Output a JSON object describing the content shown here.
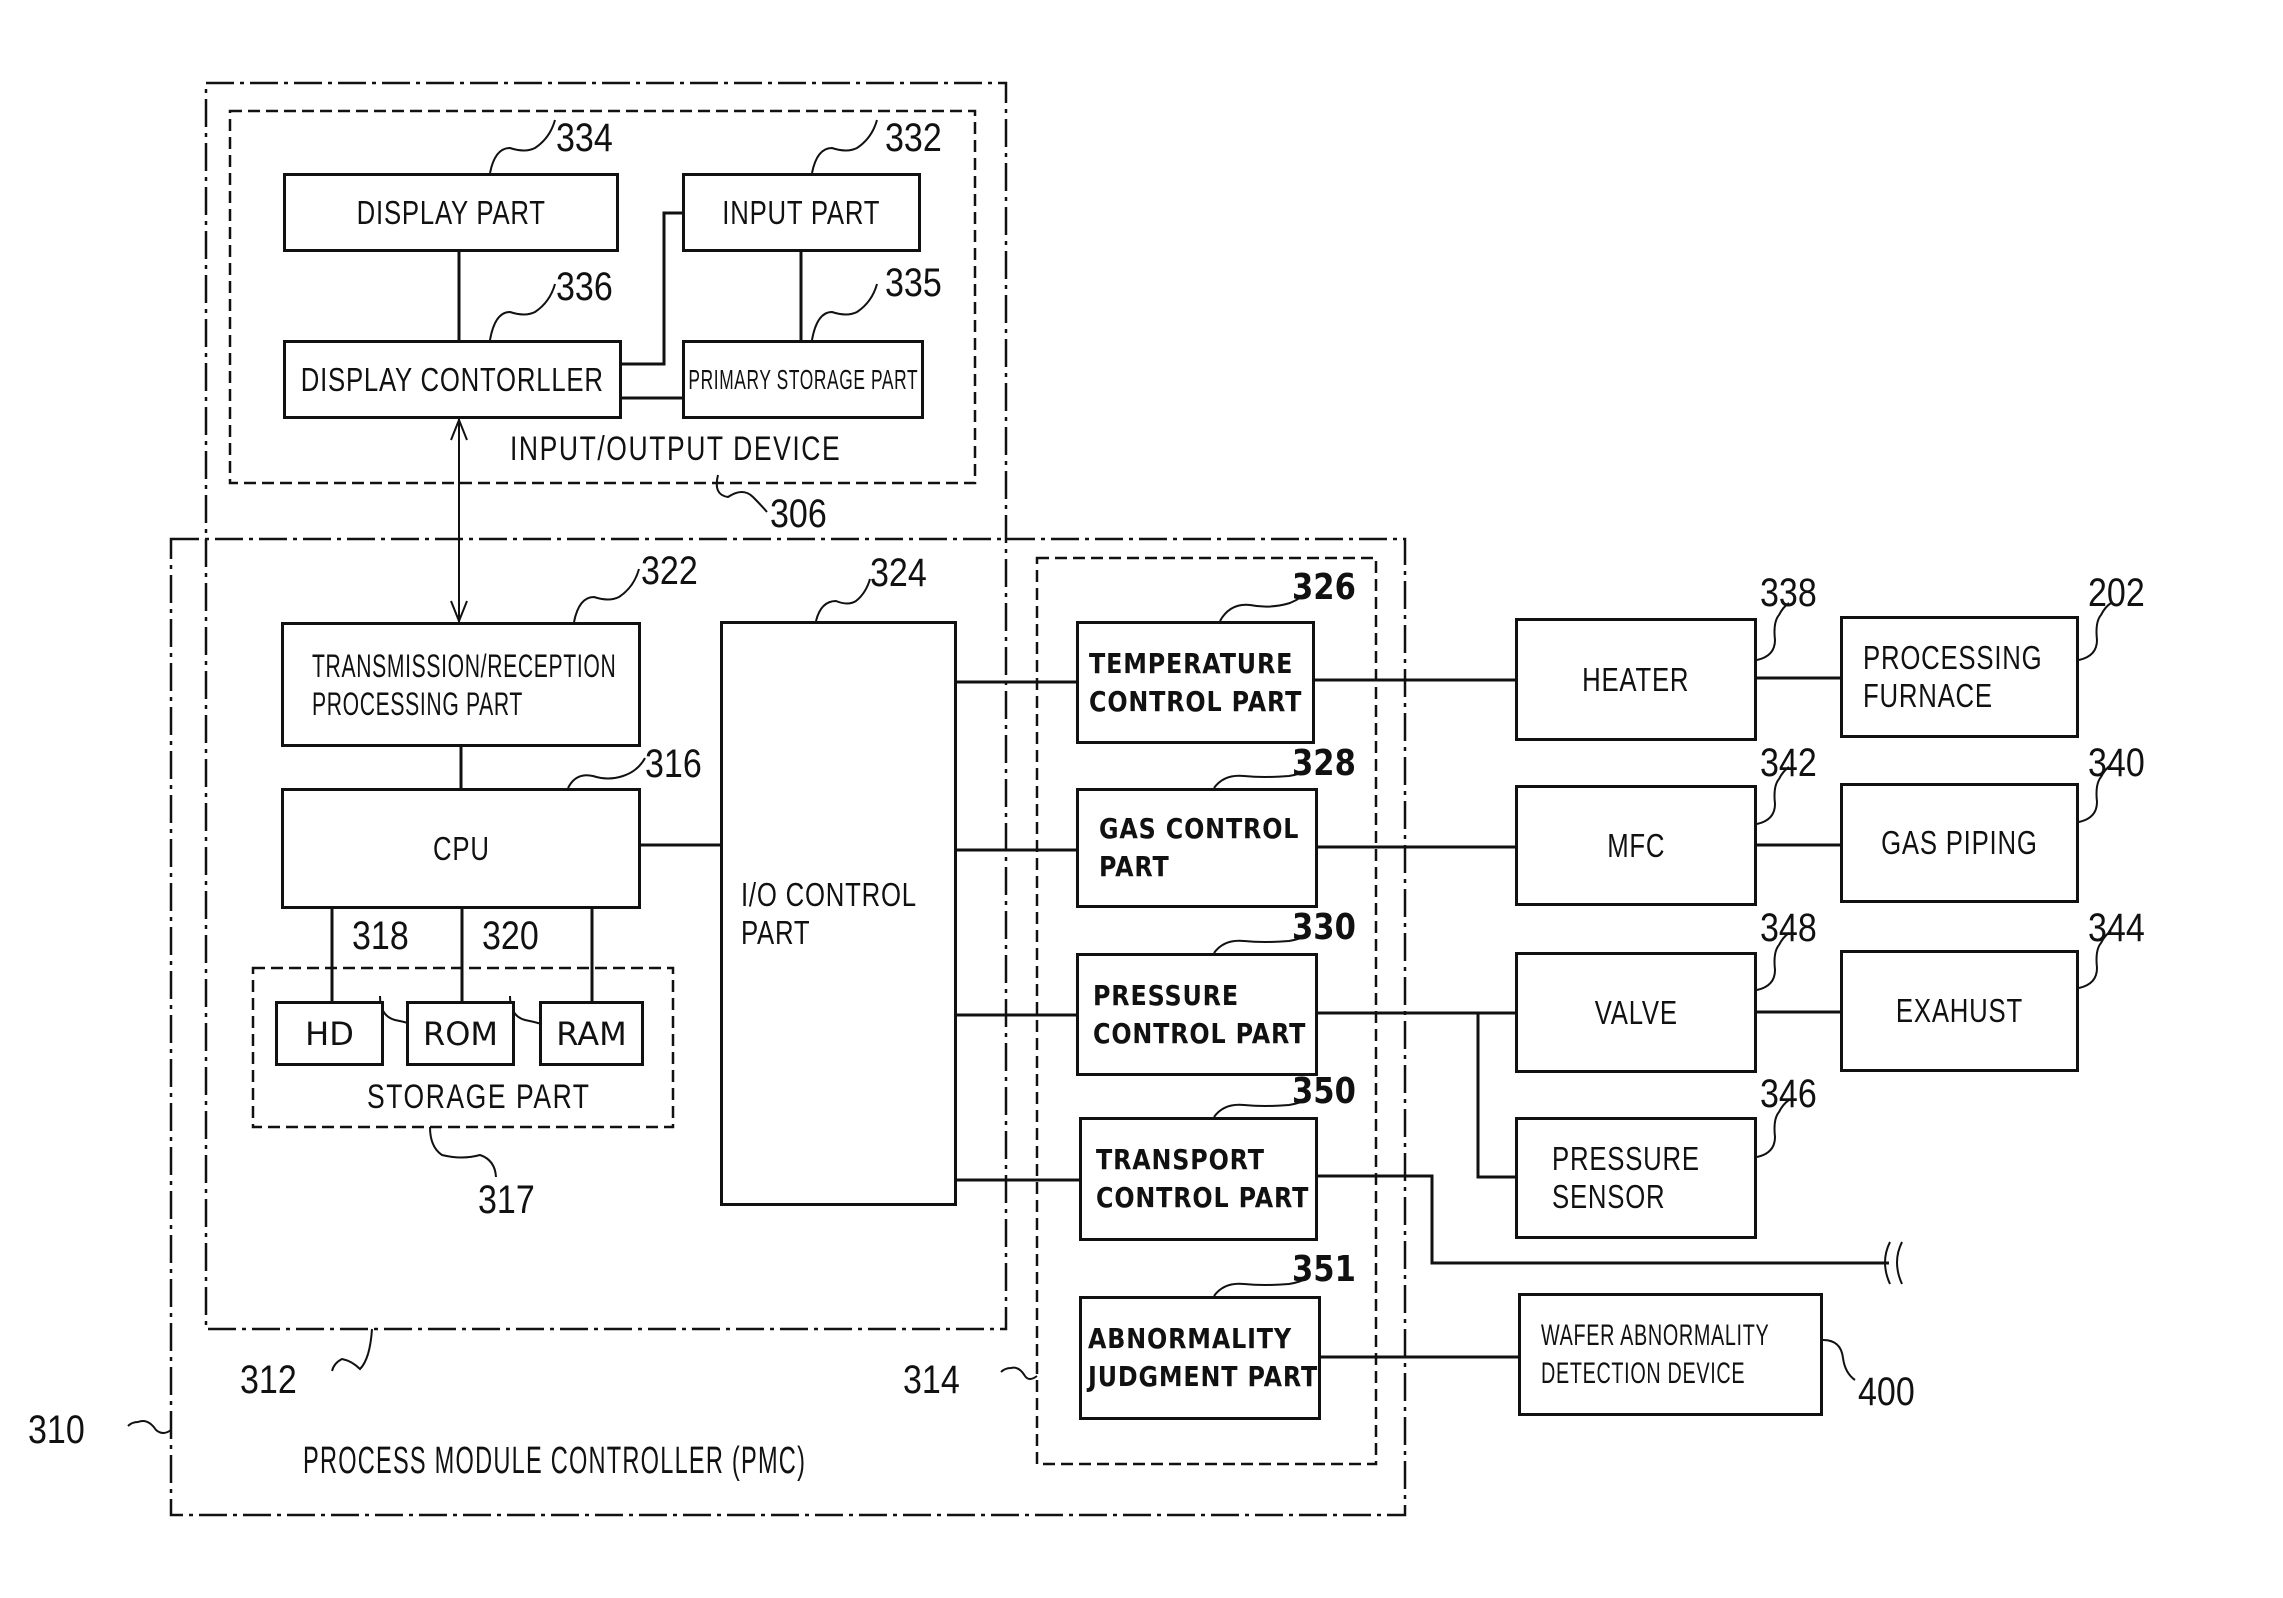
{
  "figure": {
    "groups": {
      "pmc": {
        "label": "PROCESS MODULE CONTROLLER (PMC)",
        "ref": "310"
      },
      "main_controller": {
        "ref": "312"
      },
      "io_device": {
        "label": "INPUT/OUTPUT DEVICE",
        "ref": "306"
      },
      "control_parts": {
        "ref": "314"
      },
      "storage": {
        "label": "STORAGE PART",
        "ref": "317"
      }
    },
    "blocks": {
      "display_part": {
        "label": "DISPLAY PART",
        "ref": "334"
      },
      "input_part": {
        "label": "INPUT PART",
        "ref": "332"
      },
      "display_controller": {
        "label": "DISPLAY CONTORLLER",
        "ref": "336"
      },
      "primary_storage": {
        "label": "PRIMARY STORAGE PART",
        "ref": "335"
      },
      "trans_recep": {
        "label": "TRANSMISSION/RECEPTION\nPROCESSING PART",
        "ref": "322"
      },
      "cpu": {
        "label": "CPU",
        "ref": "316"
      },
      "hd": {
        "label": "HD"
      },
      "rom": {
        "label": "ROM",
        "ref": "318"
      },
      "ram": {
        "label": "RAM",
        "ref": "320"
      },
      "io_control": {
        "label": "I/O CONTROL\nPART",
        "ref": "324"
      },
      "temp_control": {
        "label": "TEMPERATURE\nCONTROL PART",
        "ref": "326"
      },
      "gas_control": {
        "label": "GAS CONTROL\nPART",
        "ref": "328"
      },
      "pressure_control": {
        "label": "PRESSURE\nCONTROL PART",
        "ref": "330"
      },
      "transport_control": {
        "label": "TRANSPORT\nCONTROL PART",
        "ref": "350"
      },
      "abnormality_judgment": {
        "label": "ABNORMALITY\nJUDGMENT PART",
        "ref": "351"
      },
      "heater": {
        "label": "HEATER",
        "ref": "338"
      },
      "processing_furnace": {
        "label": "PROCESSING\nFURNACE",
        "ref": "202"
      },
      "mfc": {
        "label": "MFC",
        "ref": "342"
      },
      "gas_piping": {
        "label": "GAS PIPING",
        "ref": "340"
      },
      "valve": {
        "label": "VALVE",
        "ref": "348"
      },
      "exhaust": {
        "label": "EXAHUST",
        "ref": "344"
      },
      "pressure_sensor": {
        "label": "PRESSURE\nSENSOR",
        "ref": "346"
      },
      "wafer_abnormality": {
        "label": "WAFER ABNORMALITY\nDETECTION DEVICE",
        "ref": "400"
      }
    },
    "break_symbol": "))"
  }
}
